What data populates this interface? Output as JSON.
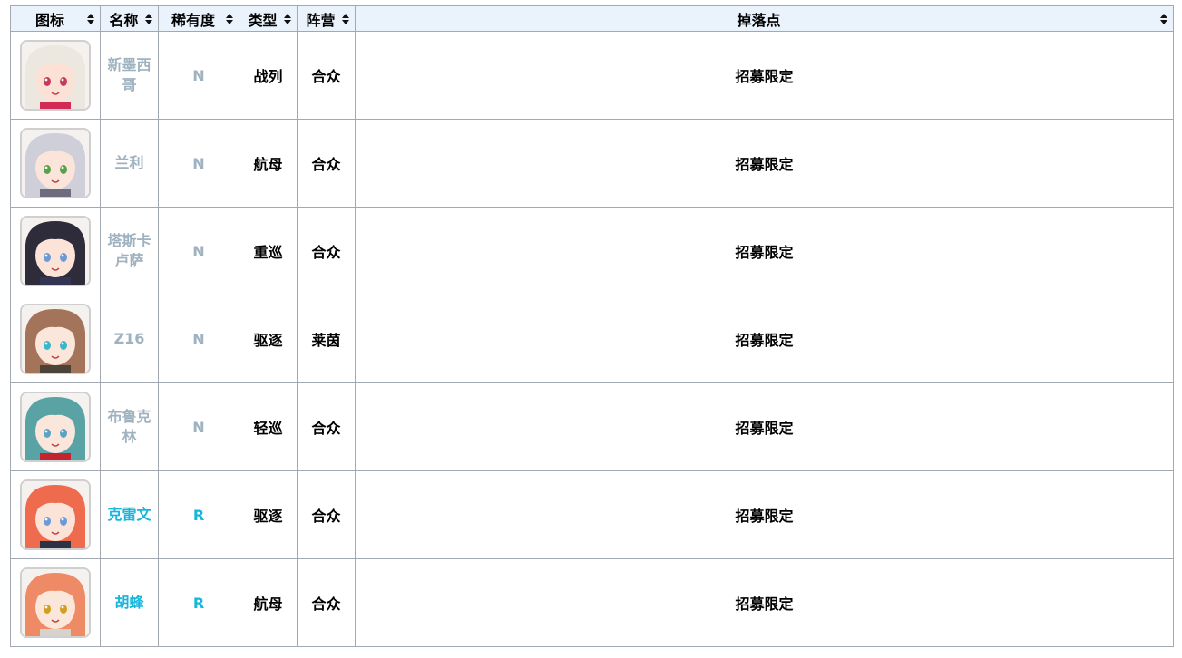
{
  "table": {
    "headers": {
      "icon": "图标",
      "name": "名称",
      "rarity": "稀有度",
      "type": "类型",
      "faction": "阵营",
      "drop": "掉落点"
    },
    "rows": [
      {
        "name": "新墨西哥",
        "rarity": "N",
        "type": "战列",
        "faction": "合众",
        "drop": "招募限定",
        "icon": "new-mexico-portrait-icon",
        "hair": "#ece7df",
        "accent": "#d12a54",
        "skin": "#fbe1d6",
        "eye": "#c53a5a"
      },
      {
        "name": "兰利",
        "rarity": "N",
        "type": "航母",
        "faction": "合众",
        "drop": "招募限定",
        "icon": "langley-portrait-icon",
        "hair": "#cfcfd9",
        "accent": "#6d6d7d",
        "skin": "#fbe4da",
        "eye": "#5aa04a"
      },
      {
        "name": "塔斯卡卢萨",
        "rarity": "N",
        "type": "重巡",
        "faction": "合众",
        "drop": "招募限定",
        "icon": "tuscaloosa-portrait-icon",
        "hair": "#2e2c3a",
        "accent": "#343552",
        "skin": "#fbe3d8",
        "eye": "#6c9ad6"
      },
      {
        "name": "Z16",
        "rarity": "N",
        "type": "驱逐",
        "faction": "莱茵",
        "drop": "招募限定",
        "icon": "z16-portrait-icon",
        "hair": "#a3735a",
        "accent": "#4a4438",
        "skin": "#fbe6db",
        "eye": "#3ab6c9"
      },
      {
        "name": "布鲁克林",
        "rarity": "N",
        "type": "轻巡",
        "faction": "合众",
        "drop": "招募限定",
        "icon": "brooklyn-portrait-icon",
        "hair": "#5aa3a4",
        "accent": "#c3242d",
        "skin": "#fbe6dc",
        "eye": "#5aa3c6"
      },
      {
        "name": "克雷文",
        "rarity": "R",
        "type": "驱逐",
        "faction": "合众",
        "drop": "招募限定",
        "icon": "craven-portrait-icon",
        "hair": "#ee6b4e",
        "accent": "#2c3346",
        "skin": "#fbe3d8",
        "eye": "#6c9ad6"
      },
      {
        "name": "胡蜂",
        "rarity": "R",
        "type": "航母",
        "faction": "合众",
        "drop": "招募限定",
        "icon": "wasp-portrait-icon",
        "hair": "#ef8a66",
        "accent": "#d8d2cc",
        "skin": "#fbe6da",
        "eye": "#d2a020"
      }
    ]
  }
}
